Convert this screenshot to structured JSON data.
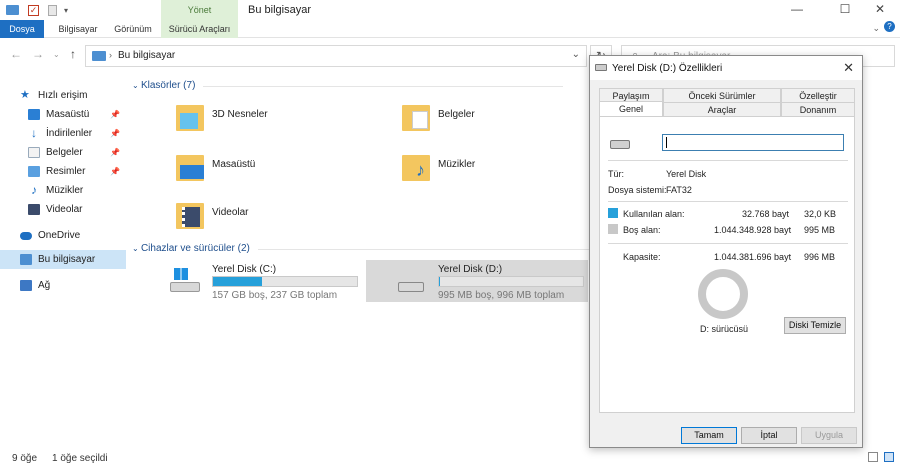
{
  "window": {
    "context_tab_group": "Yönet",
    "title": "Bu bilgisayar",
    "controls": {
      "minimize": "—",
      "maximize": "☐",
      "close": "✕"
    }
  },
  "ribbon": {
    "tabs": [
      {
        "label": "Dosya"
      },
      {
        "label": "Bilgisayar"
      },
      {
        "label": "Görünüm"
      },
      {
        "label": "Sürücü Araçları"
      }
    ]
  },
  "address": {
    "path": "Bu bilgisayar",
    "search_placeholder": "Ara: Bu bilgisayar"
  },
  "sidebar": {
    "quick_access": "Hızlı erişim",
    "items": [
      {
        "label": "Masaüstü",
        "pinned": true
      },
      {
        "label": "İndirilenler",
        "pinned": true
      },
      {
        "label": "Belgeler",
        "pinned": true
      },
      {
        "label": "Resimler",
        "pinned": true
      },
      {
        "label": "Müzikler",
        "pinned": false
      },
      {
        "label": "Videolar",
        "pinned": false
      }
    ],
    "onedrive": "OneDrive",
    "this_pc": "Bu bilgisayar",
    "network": "Ağ"
  },
  "content": {
    "folders_header": "Klasörler (7)",
    "folders": [
      {
        "label": "3D Nesneler"
      },
      {
        "label": "Belgeler"
      },
      {
        "label": "Masaüstü"
      },
      {
        "label": "Müzikler"
      },
      {
        "label": "Videolar"
      }
    ],
    "drives_header": "Cihazlar ve sürücüler (2)",
    "drives": [
      {
        "name": "Yerel Disk (C:)",
        "info": "157 GB boş, 237 GB toplam",
        "used_fraction": 0.34
      },
      {
        "name": "Yerel Disk (D:)",
        "info": "995 MB boş, 996 MB toplam",
        "used_fraction": 0.001
      }
    ]
  },
  "status": {
    "items_count": "9 öğe",
    "selected": "1 öğe seçildi"
  },
  "dialog": {
    "title": "Yerel Disk (D:) Özellikleri",
    "tabs_row1": [
      "Paylaşım",
      "Önceki Sürümler",
      "Özelleştir"
    ],
    "tabs_row2": [
      "Genel",
      "Araçlar",
      "Donanım"
    ],
    "type_label": "Tür:",
    "type_value": "Yerel Disk",
    "fs_label": "Dosya sistemi:",
    "fs_value": "FAT32",
    "used_label": "Kullanılan alan:",
    "used_bytes": "32.768 bayt",
    "used_size": "32,0 KB",
    "free_label": "Boş alan:",
    "free_bytes": "1.044.348.928 bayt",
    "free_size": "995 MB",
    "capacity_label": "Kapasite:",
    "capacity_bytes": "1.044.381.696 bayt",
    "capacity_size": "996 MB",
    "drive_label": "D: sürücüsü",
    "cleanup_button": "Diski Temizle",
    "ok_button": "Tamam",
    "cancel_button": "İptal",
    "apply_button": "Uygula",
    "colors": {
      "used": "#26a0da",
      "free": "#c8c8c8"
    }
  }
}
